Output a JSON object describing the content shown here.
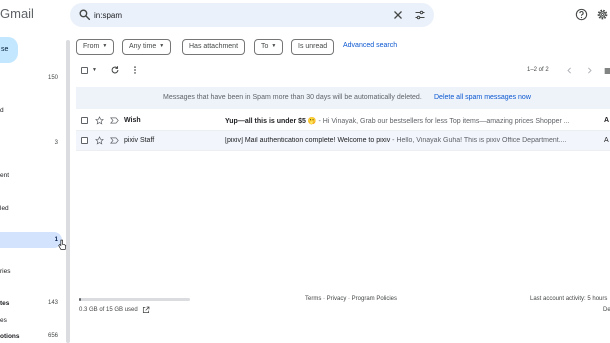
{
  "header": {
    "app_name": "Gmail",
    "search_value": "in:spam",
    "icons": [
      "search-icon",
      "clear-icon",
      "search-options-icon",
      "help-icon",
      "settings-icon"
    ]
  },
  "sidebar": {
    "compose_label": "se",
    "items": [
      {
        "label": "",
        "count": "150"
      },
      {
        "label": "d",
        "count": ""
      },
      {
        "label": "",
        "count": "3"
      },
      {
        "label": "ent",
        "count": ""
      },
      {
        "label": "led",
        "count": ""
      },
      {
        "label": "",
        "count": "1"
      },
      {
        "label": "ries",
        "count": ""
      },
      {
        "label": "tes",
        "count": "143"
      },
      {
        "label": "es",
        "count": ""
      },
      {
        "label": "otions",
        "count": "656"
      }
    ]
  },
  "filters": {
    "chips": [
      {
        "label": "From",
        "caret": true
      },
      {
        "label": "Any time",
        "caret": true
      },
      {
        "label": "Has attachment",
        "caret": false
      },
      {
        "label": "To",
        "caret": true
      },
      {
        "label": "Is unread",
        "caret": false
      }
    ],
    "advanced_link": "Advanced search"
  },
  "toolbar": {
    "page_count": "1–2 of 2"
  },
  "banner": {
    "text": "Messages that have been in Spam more than 30 days will be automatically deleted.",
    "link": "Delete all spam messages now"
  },
  "emails": [
    {
      "sender": "Wish",
      "subject": "Yup—all this is under $5 🫢",
      "snippet": " - Hi Vinayak, Grab our bestsellers for less Top items—amazing prices Shopper ...",
      "date": "A",
      "unread": true
    },
    {
      "sender": "pixiv Staff",
      "subject": "[pixiv] Mail authentication complete! Welcome to pixiv",
      "snippet": " - Hello, Vinayak Guha! This is pixiv Office Department....",
      "date": "A",
      "unread": false
    }
  ],
  "footer": {
    "storage_text": "0.3 GB of 15 GB used",
    "storage_used_fraction": 0.02,
    "links": "Terms · Privacy · Program Policies",
    "last_activity": "Last account activity: 5 hours",
    "details": "De"
  },
  "colors": {
    "accent": "#0b57d0",
    "search_bg": "#eaf1fb",
    "compose_bg": "#c2e7ff",
    "active_nav_bg": "#d3e3fd",
    "banner_bg": "#eef3fa"
  }
}
